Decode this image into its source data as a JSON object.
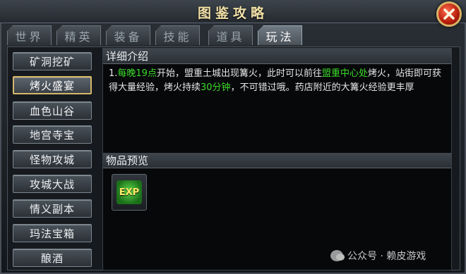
{
  "title": "图鉴攻略",
  "tabs": [
    {
      "label": "世界"
    },
    {
      "label": "精英"
    },
    {
      "label": "装备"
    },
    {
      "label": "技能"
    },
    {
      "label": "道具"
    },
    {
      "label": "玩法"
    }
  ],
  "active_tab": "玩法",
  "sidebar": {
    "items": [
      {
        "label": "矿洞挖矿"
      },
      {
        "label": "烤火盛宴"
      },
      {
        "label": "血色山谷"
      },
      {
        "label": "地宫寺宝"
      },
      {
        "label": "怪物攻城"
      },
      {
        "label": "攻城大战"
      },
      {
        "label": "情义副本"
      },
      {
        "label": "玛法宝箱"
      },
      {
        "label": "酿酒"
      }
    ],
    "selected": "烤火盛宴"
  },
  "detail": {
    "heading": "详细介绍",
    "text_parts": {
      "p1": "1.",
      "p2": "每晚19点",
      "p3": "开始，盟重土城出现篝火，此时可以前往",
      "p4": "盟重中心处",
      "p5": "烤火，站街即可获得大量经验，烤火持续",
      "p6": "30分钟",
      "p7": "，不可错过哦。药店附近的大篝火经验更丰厚"
    }
  },
  "preview": {
    "heading": "物品预览",
    "item_label": "EXP"
  },
  "watermark": "公众号 · 赖皮游戏",
  "colors": {
    "highlight": "#3cdb2c",
    "title": "#f1e0a7",
    "active_border": "#d4b76a"
  }
}
